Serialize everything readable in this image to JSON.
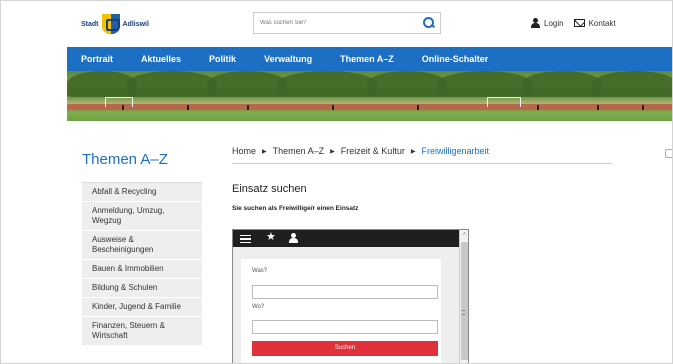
{
  "header": {
    "logo": {
      "prefix": "Stadt",
      "name": "Adliswil"
    },
    "search": {
      "placeholder": "Was suchen Sie?"
    },
    "links": {
      "login": "Login",
      "contact": "Kontakt"
    }
  },
  "nav": {
    "items": [
      "Portrait",
      "Aktuelles",
      "Politik",
      "Verwaltung",
      "Themen A–Z",
      "Online-Schalter"
    ]
  },
  "sidebar": {
    "title": "Themen A–Z",
    "items": [
      "Abfall & Recycling",
      "Anmeldung, Umzug, Wegzug",
      "Ausweise & Bescheinigungen",
      "Bauen & Immobilien",
      "Bildung & Schulen",
      "Kinder, Jugend & Familie",
      "Finanzen, Steuern & Wirtschaft"
    ]
  },
  "breadcrumb": {
    "items": [
      "Home",
      "Themen A–Z",
      "Freizeit & Kultur",
      "Freiwilligenarbeit"
    ],
    "separator": "▶"
  },
  "main": {
    "title": "Einsatz suchen",
    "subtitle": "Sie suchen als Freiwillige/r einen Einsatz"
  },
  "widget": {
    "star": "★",
    "scroll_up": "˄",
    "fields": {
      "what_label": "Was?",
      "where_label": "Wo?"
    },
    "submit_label": "Suchen"
  },
  "colors": {
    "brand_blue": "#1c6fc3",
    "submit_red": "#e0303a",
    "widget_bar": "#1f1f1f"
  }
}
